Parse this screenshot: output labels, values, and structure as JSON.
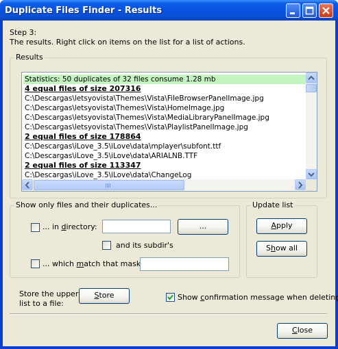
{
  "window": {
    "title": "Duplicate Files Finder - Results"
  },
  "step": {
    "line1": "Step 3:",
    "line2": "The results. Right click on items on the list for a list of actions."
  },
  "results": {
    "group_label": "Results",
    "rows": [
      {
        "kind": "stats",
        "text": "Statistics: 50 duplicates of 32 files consume 1.28 mb"
      },
      {
        "kind": "header",
        "text": "4 equal files of size 207316"
      },
      {
        "kind": "file",
        "text": "C:\\Descargas\\letsyovista\\Themes\\Vista\\FileBrowserPanelImage.jpg"
      },
      {
        "kind": "file",
        "text": "C:\\Descargas\\letsyovista\\Themes\\Vista\\HomeImage.jpg"
      },
      {
        "kind": "file",
        "text": "C:\\Descargas\\letsyovista\\Themes\\Vista\\MediaLibraryPanelImage.jpg"
      },
      {
        "kind": "file",
        "text": "C:\\Descargas\\letsyovista\\Themes\\Vista\\PlaylistPanelImage.jpg"
      },
      {
        "kind": "header",
        "text": "2 equal files of size 178864"
      },
      {
        "kind": "file",
        "text": "C:\\Descargas\\iLove_3.5\\iLove\\data\\mplayer\\subfont.ttf"
      },
      {
        "kind": "file",
        "text": "C:\\Descargas\\iLove_3.5\\iLove\\data\\ARIALNB.TTF"
      },
      {
        "kind": "header",
        "text": "2 equal files of size 113347"
      },
      {
        "kind": "file",
        "text": "C:\\Descargas\\iLove_3.5\\iLove\\data\\ChangeLog"
      }
    ]
  },
  "filter": {
    "group_label": "Show only files and their duplicates...",
    "in_dir_pre": "... in ",
    "in_dir_u": "d",
    "in_dir_post": "irectory:",
    "browse_label": "...",
    "subdirs_label": "and its subdir's",
    "mask_pre": "... which ",
    "mask_u": "m",
    "mask_post": "atch that mask:",
    "directory_value": "",
    "mask_value": ""
  },
  "update": {
    "group_label": "Update list",
    "apply_u": "A",
    "apply_rest": "pply",
    "showall_pre": "S",
    "showall_u": "h",
    "showall_post": "ow all"
  },
  "store": {
    "label_line1": "Store the upper",
    "label_line2": "list to a file:",
    "button_u": "S",
    "button_rest": "tore"
  },
  "confirm": {
    "pre": "Show ",
    "u": "c",
    "post": "onfirmation message when deleting",
    "checked": true
  },
  "close": {
    "u": "C",
    "rest": "lose"
  },
  "colors": {
    "title_bar": "#0a5ce8",
    "stats_row": "#c4f5c1",
    "dialog_face": "#ece9d8"
  }
}
